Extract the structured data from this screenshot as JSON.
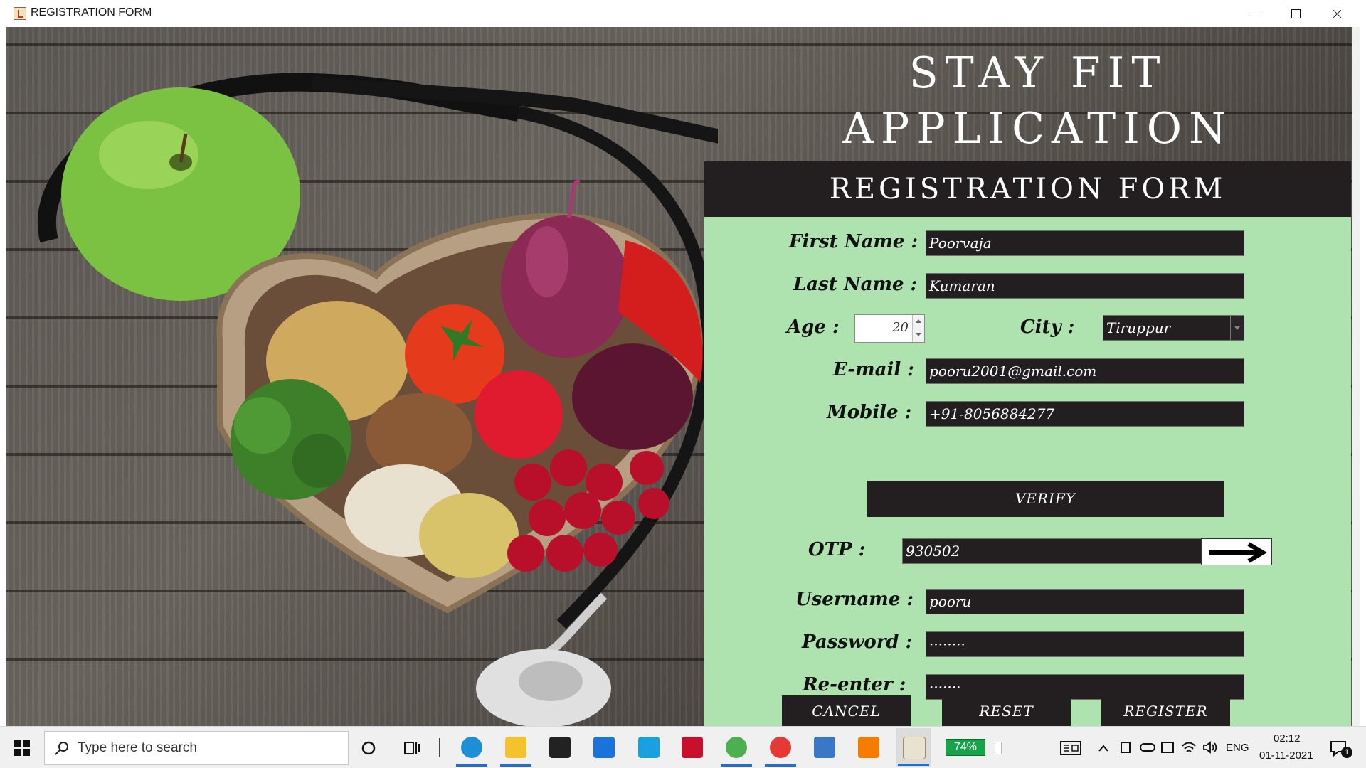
{
  "window": {
    "title": "REGISTRATION FORM"
  },
  "app": {
    "headline_line1": "STAY FIT",
    "headline_line2": "APPLICATION",
    "form_title": "REGISTRATION FORM"
  },
  "form": {
    "first_name": {
      "label": "First Name :",
      "value": "Poorvaja"
    },
    "last_name": {
      "label": "Last Name :",
      "value": "Kumaran"
    },
    "age": {
      "label": "Age :",
      "value": "20"
    },
    "city": {
      "label": "City :",
      "value": "Tiruppur"
    },
    "email": {
      "label": "E-mail :",
      "value": "pooru2001@gmail.com"
    },
    "mobile": {
      "label": "Mobile :",
      "value": "+91-8056884277"
    },
    "verify_label": "VERIFY",
    "otp": {
      "label": "OTP :",
      "value": "930502"
    },
    "username": {
      "label": "Username :",
      "value": "pooru"
    },
    "password": {
      "label": "Password :",
      "value": "········"
    },
    "reenter": {
      "label": "Re-enter :",
      "value": "·······"
    },
    "cancel_label": "CANCEL",
    "reset_label": "RESET",
    "register_label": "REGISTER"
  },
  "taskbar": {
    "search_placeholder": "Type here to search",
    "battery": "74%",
    "language": "ENG",
    "time": "02:12",
    "date": "01-11-2021",
    "notification_count": "1",
    "apps": [
      "task-view",
      "edge",
      "file-explorer",
      "store",
      "mail",
      "app-l",
      "mcafee",
      "chrome",
      "chrome-profile",
      "virtualbox",
      "app-orange",
      "java"
    ]
  }
}
